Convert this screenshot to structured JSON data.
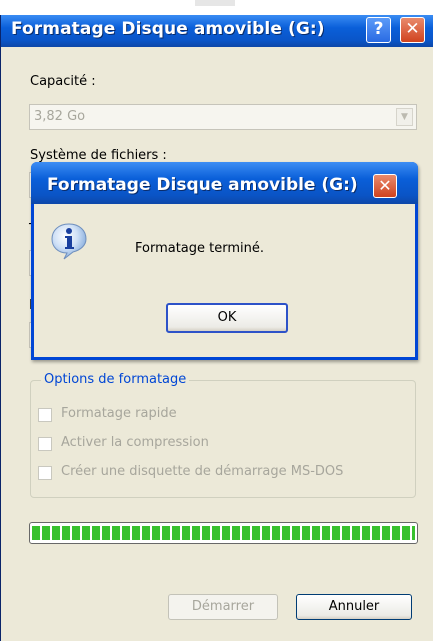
{
  "window": {
    "title": "Formatage Disque amovible (G:)",
    "help_glyph": "?",
    "close_glyph": "✕"
  },
  "form": {
    "capacity_label": "Capacité :",
    "capacity_value": "3,82 Go",
    "filesystem_label": "Système de fichiers :",
    "partial_label_1": "T",
    "partial_label_2": "N"
  },
  "options": {
    "title": "Options de formatage",
    "items": [
      {
        "label": "Formatage rapide",
        "checked": false
      },
      {
        "label": "Activer la compression",
        "checked": false
      },
      {
        "label": "Créer une disquette de démarrage MS-DOS",
        "checked": false
      }
    ]
  },
  "progress": {
    "value_percent": 100,
    "color": "#38c12d"
  },
  "buttons": {
    "start": "Démarrer",
    "cancel": "Annuler"
  },
  "dialog": {
    "title": "Formatage Disque amovible (G:)",
    "message": "Formatage terminé.",
    "ok": "OK",
    "icon": "info-icon"
  },
  "colors": {
    "titlebar": "#0a5fd9",
    "dialog_bg": "#ece9d8",
    "accent_text": "#0046d5"
  }
}
